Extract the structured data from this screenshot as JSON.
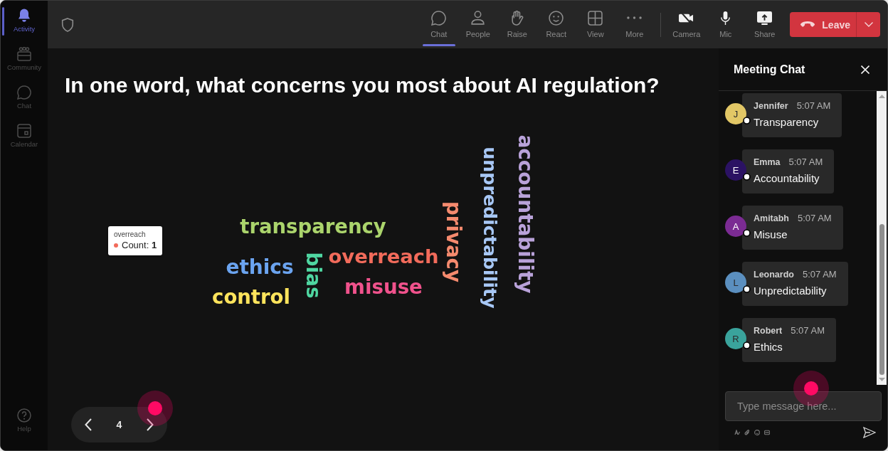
{
  "sidebar": {
    "items": [
      {
        "label": "Activity",
        "selected": true
      },
      {
        "label": "Community",
        "selected": false
      },
      {
        "label": "Chat",
        "selected": false
      },
      {
        "label": "Calendar",
        "selected": false
      }
    ],
    "help": {
      "label": "Help"
    }
  },
  "toolbar": {
    "items": [
      {
        "label": "Chat",
        "selected": true
      },
      {
        "label": "People",
        "selected": false
      },
      {
        "label": "Raise",
        "selected": false
      },
      {
        "label": "React",
        "selected": false
      },
      {
        "label": "View",
        "selected": false
      },
      {
        "label": "More",
        "selected": false
      }
    ],
    "devices": [
      {
        "label": "Camera"
      },
      {
        "label": "Mic"
      },
      {
        "label": "Share"
      }
    ],
    "leave_button": {
      "label": "Leave"
    }
  },
  "poll": {
    "question": "In one word, what concerns you most about AI regulation?",
    "words": [
      {
        "text": "accountability",
        "kind": "vertical",
        "color": "#b9a2d9"
      },
      {
        "text": "unpredictability",
        "kind": "vertical",
        "color": "#a7c7f5"
      },
      {
        "text": "privacy",
        "kind": "vertical",
        "color": "#f58a6e"
      },
      {
        "text": "transparency",
        "kind": "horizontal",
        "color": "#abd46c"
      },
      {
        "text": "overreach",
        "kind": "horizontal",
        "color": "#f26b5b"
      },
      {
        "text": "ethics",
        "kind": "horizontal",
        "color": "#6ba4f0"
      },
      {
        "text": "bias",
        "kind": "vertical",
        "color": "#4fd6a1"
      },
      {
        "text": "misuse",
        "kind": "horizontal",
        "color": "#f0528c"
      },
      {
        "text": "control",
        "kind": "horizontal",
        "color": "#ffe45c"
      }
    ],
    "tooltip": {
      "title": "overreach",
      "text": "Count: **1**",
      "color": "#f26b5b"
    }
  },
  "pager": {
    "page": "4"
  },
  "chat": {
    "title": "Meeting Chat",
    "messages": [
      {
        "author": "Jennifer",
        "initial": "J",
        "time": "5:07 AM",
        "text": "Transparency",
        "color": "#e2c766"
      },
      {
        "author": "Emma",
        "initial": "E",
        "time": "5:07 AM",
        "text": "Accountability",
        "color": "#2b1263"
      },
      {
        "author": "Amitabh",
        "initial": "A",
        "time": "5:07 AM",
        "text": "Misuse",
        "color": "#7b2b93"
      },
      {
        "author": "Leonardo",
        "initial": "L",
        "time": "5:07 AM",
        "text": "Unpredictability",
        "color": "#5b8fbf"
      },
      {
        "author": "Robert",
        "initial": "R",
        "time": "5:07 AM",
        "text": "Ethics",
        "color": "#3aa39c"
      }
    ],
    "composer": {
      "placeholder": "Type message here..."
    }
  }
}
